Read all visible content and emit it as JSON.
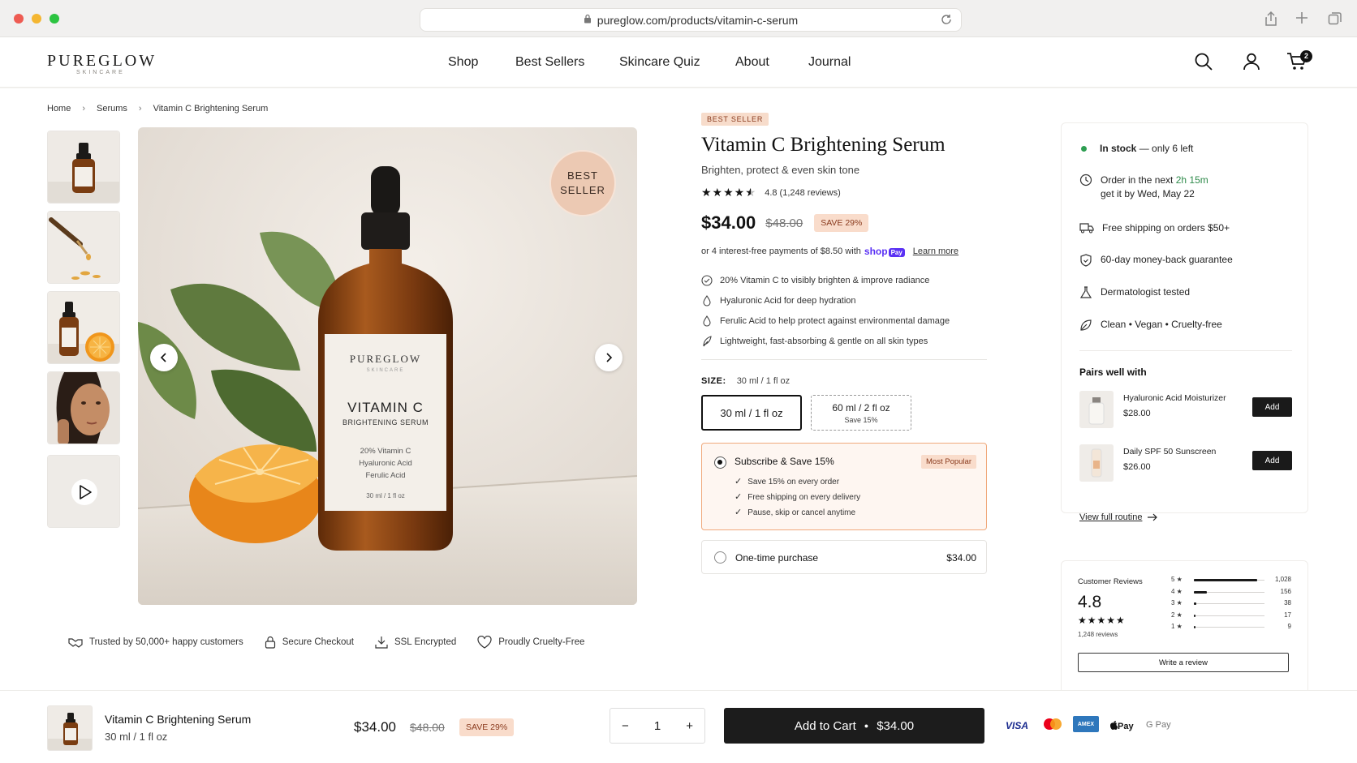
{
  "browser": {
    "url": "pureglow.com/products/vitamin-c-serum"
  },
  "brand": {
    "name": "PUREGLOW",
    "tagline": "SKINCARE"
  },
  "nav": [
    "Shop",
    "Best Sellers",
    "Skincare Quiz",
    "About",
    "Journal"
  ],
  "cart_count": "2",
  "breadcrumb": [
    "Home",
    "Serums",
    "Vitamin C Brightening Serum"
  ],
  "gallery": {
    "badge_line1": "BEST",
    "badge_line2": "SELLER",
    "bottle": {
      "brand": "PUREGLOW",
      "sub": "SKINCARE",
      "name": "VITAMIN C",
      "type": "BRIGHTENING SERUM",
      "ing1": "20% Vitamin C",
      "ing2": "Hyaluronic Acid",
      "ing3": "Ferulic Acid",
      "vol": "30 ml / 1 fl oz"
    }
  },
  "trust": [
    "Trusted by 50,000+ happy customers",
    "Secure Checkout",
    "SSL Encrypted",
    "Proudly Cruelty-Free"
  ],
  "product": {
    "tag": "BEST SELLER",
    "title": "Vitamin C Brightening Serum",
    "subtitle": "Brighten, protect & even skin tone",
    "rating": 4.5,
    "rating_text": "4.8 (1,248 reviews)",
    "price": "$34.00",
    "old_price": "$48.00",
    "save": "SAVE 29%",
    "install_pre": "or 4 interest-free payments of $8.50 with",
    "shop_label": "shop",
    "pay_label": "Pay",
    "learn_more": "Learn more",
    "bullets": [
      "20% Vitamin C to visibly brighten & improve radiance",
      "Hyaluronic Acid for deep hydration",
      "Ferulic Acid to help protect against environmental damage",
      "Lightweight, fast-absorbing & gentle on all skin types"
    ],
    "size_label": "SIZE:",
    "size_value": "30 ml / 1 fl oz",
    "sizes": [
      {
        "label": "30 ml / 1 fl oz",
        "sub": ""
      },
      {
        "label": "60 ml / 2 fl oz",
        "sub": "Save 15%"
      }
    ],
    "subscribe": {
      "title": "Subscribe & Save 15%",
      "badge": "Most Popular",
      "perks": [
        "Save 15% on every order",
        "Free shipping on every delivery",
        "Pause, skip or cancel anytime"
      ]
    },
    "one_time": {
      "label": "One-time purchase",
      "price": "$34.00"
    }
  },
  "side": {
    "stock_bold": "In stock",
    "stock_rest": " — only 6 left",
    "order_pre": "Order in the next ",
    "order_time": "2h 15m",
    "order_line2": "get it by Wed, May 22",
    "perks": [
      "Free shipping on orders $50+",
      "60-day money-back guarantee",
      "Dermatologist tested",
      "Clean • Vegan • Cruelty-free"
    ],
    "pairs_title": "Pairs well with",
    "pairs": [
      {
        "name": "Hyaluronic Acid Moisturizer",
        "price": "$28.00",
        "btn": "Add"
      },
      {
        "name": "Daily SPF 50 Sunscreen",
        "price": "$26.00",
        "btn": "Add"
      }
    ],
    "routine": "View full routine"
  },
  "reviews": {
    "title": "Customer Reviews",
    "score": "4.8",
    "count": "1,248 reviews",
    "bars": [
      {
        "label": "5 ★",
        "count": "1,028",
        "pct": 0.9
      },
      {
        "label": "4 ★",
        "count": "156",
        "pct": 0.18
      },
      {
        "label": "3 ★",
        "count": "38",
        "pct": 0.04
      },
      {
        "label": "2 ★",
        "count": "17",
        "pct": 0.02
      },
      {
        "label": "1 ★",
        "count": "9",
        "pct": 0.01
      }
    ],
    "write": "Write a review"
  },
  "sticky": {
    "name": "Vitamin C Brightening Serum",
    "size": "30 ml / 1 fl oz",
    "price": "$34.00",
    "old_price": "$48.00",
    "save": "SAVE 29%",
    "qty": "1",
    "atc_label": "Add to Cart",
    "atc_price": "$34.00",
    "payments": [
      "VISA",
      "Mastercard",
      "AMEX",
      "Apple Pay",
      "G Pay"
    ]
  },
  "colors": {
    "accent": "#f0a97c",
    "badge_bg": "#f9dccb",
    "in_stock": "#2e9e52"
  }
}
